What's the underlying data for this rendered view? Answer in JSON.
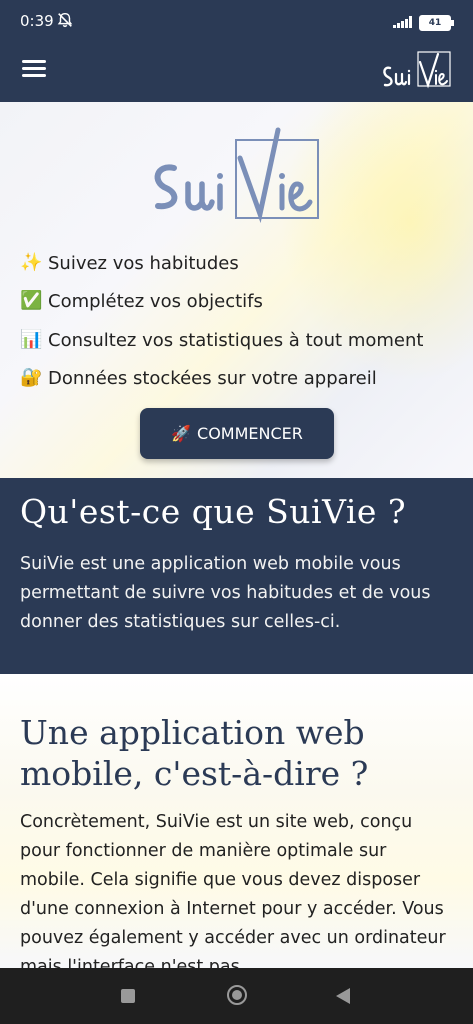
{
  "status_bar": {
    "time": "0:39",
    "battery": "41",
    "icons": [
      "mute-bell-icon",
      "signal-icon",
      "battery-icon"
    ]
  },
  "navbar": {
    "menu_icon": "hamburger-menu-icon",
    "logo_text": "SuiVie"
  },
  "hero": {
    "logo_text": "SuiVie",
    "features": [
      {
        "icon": "sparkles-icon",
        "emoji": "✨",
        "text": "Suivez vos habitudes"
      },
      {
        "icon": "check-mark-icon",
        "emoji": "✅",
        "text": "Complétez vos objectifs"
      },
      {
        "icon": "bar-chart-icon",
        "emoji": "📊",
        "text": "Consultez vos statistiques à tout moment"
      },
      {
        "icon": "lock-key-icon",
        "emoji": "🔐",
        "text": "Données stockées sur votre appareil"
      }
    ],
    "cta_icon": "rocket-icon",
    "cta_label": "COMMENCER"
  },
  "about": {
    "title": "Qu'est-ce que SuiVie ?",
    "body": "SuiVie est une application web mobile vous permettant de suivre vos habitudes et de vous donner des statistiques sur celles-ci."
  },
  "webapp": {
    "title": "Une application web mobile, c'est-à-dire ?",
    "body": "Concrètement, SuiVie est un site web, conçu pour fonctionner de manière optimale sur mobile. Cela signifie que vous devez disposer d'une connexion à Internet pour y accéder. Vous pouvez également y accéder avec un ordinateur mais l'interface n'est pas"
  },
  "system_nav": {
    "icons": [
      "recent-apps-icon",
      "home-icon",
      "back-icon"
    ]
  },
  "colors": {
    "primary": "#2b3a55",
    "logo_blue": "#7b8fb8",
    "system_nav": "#1f1f1f"
  }
}
